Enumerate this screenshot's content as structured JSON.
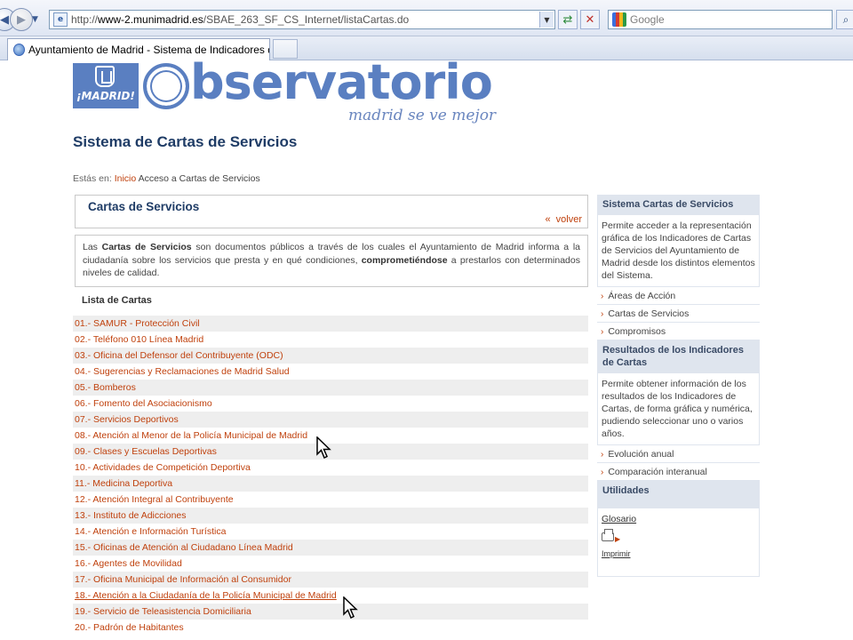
{
  "browser": {
    "url_prefix": "http://",
    "url_domain": "www-2.munimadrid.es",
    "url_path": "/SBAE_263_SF_CS_Internet/listaCartas.do",
    "search_placeholder": "Google",
    "tab_title": "Ayuntamiento de Madrid - Sistema de Indicadores de ..."
  },
  "header": {
    "madrid_logo_text": "¡MADRID!",
    "brand_text": "bservatorio",
    "tagline": "madrid se ve mejor"
  },
  "page": {
    "title": "Sistema de Cartas de Servicios",
    "breadcrumb_prefix": "Estás en:",
    "breadcrumb_home": "Inicio",
    "breadcrumb_current": "Acceso a Cartas de Servicios"
  },
  "main": {
    "panel_title": "Cartas de Servicios",
    "back_arrows": "«",
    "back_label": "volver",
    "intro": {
      "t1": "Las ",
      "b1": "Cartas de Servicios",
      "t2": " son documentos públicos a través de los cuales el Ayuntamiento de Madrid informa a la ciudadanía sobre los servicios que presta y en qué condiciones, ",
      "b2": "comprometiéndose",
      "t3": " a prestarlos con determinados niveles de calidad."
    },
    "list_heading": "Lista de Cartas",
    "cartas": [
      "01.- SAMUR - Protección Civil",
      "02.- Teléfono 010 Línea Madrid",
      "03.- Oficina del Defensor del Contribuyente (ODC)",
      "04.- Sugerencias y Reclamaciones de Madrid Salud",
      "05.- Bomberos",
      "06.- Fomento del Asociacionismo",
      "07.- Servicios Deportivos",
      "08.- Atención al Menor de la Policía Municipal de Madrid",
      "09.- Clases y Escuelas Deportivas",
      "10.- Actividades de Competición Deportiva",
      "11.- Medicina Deportiva",
      "12.- Atención Integral al Contribuyente",
      "13.- Instituto de Adicciones",
      "14.- Atención e Información Turística",
      "15.- Oficinas de Atención al Ciudadano Línea Madrid",
      "16.- Agentes de Movilidad",
      "17.- Oficina Municipal de Información al Consumidor",
      "18.- Atención a la Ciudadanía de la Policía Municipal de Madrid",
      "19.- Servicio de Teleasistencia Domiciliaria",
      "20.- Padrón de Habitantes"
    ]
  },
  "sidebar": {
    "section1_title": "Sistema Cartas de Servicios",
    "section1_body": "Permite acceder a la representación gráfica de los Indicadores de Cartas de Servicios del Ayuntamiento de Madrid desde los distintos elementos del Sistema.",
    "section1_links": [
      "Áreas de Acción",
      "Cartas de Servicios",
      "Compromisos"
    ],
    "section2_title": "Resultados de los Indicadores de Cartas",
    "section2_body": "Permite obtener información de los resultados de los Indicadores de Cartas, de forma gráfica y numérica, pudiendo seleccionar uno o varios años.",
    "section2_links": [
      "Evolución anual",
      "Comparación interanual"
    ],
    "section3_title": "Utilidades",
    "glosario": "Glosario",
    "imprimir": "Imprimir"
  }
}
